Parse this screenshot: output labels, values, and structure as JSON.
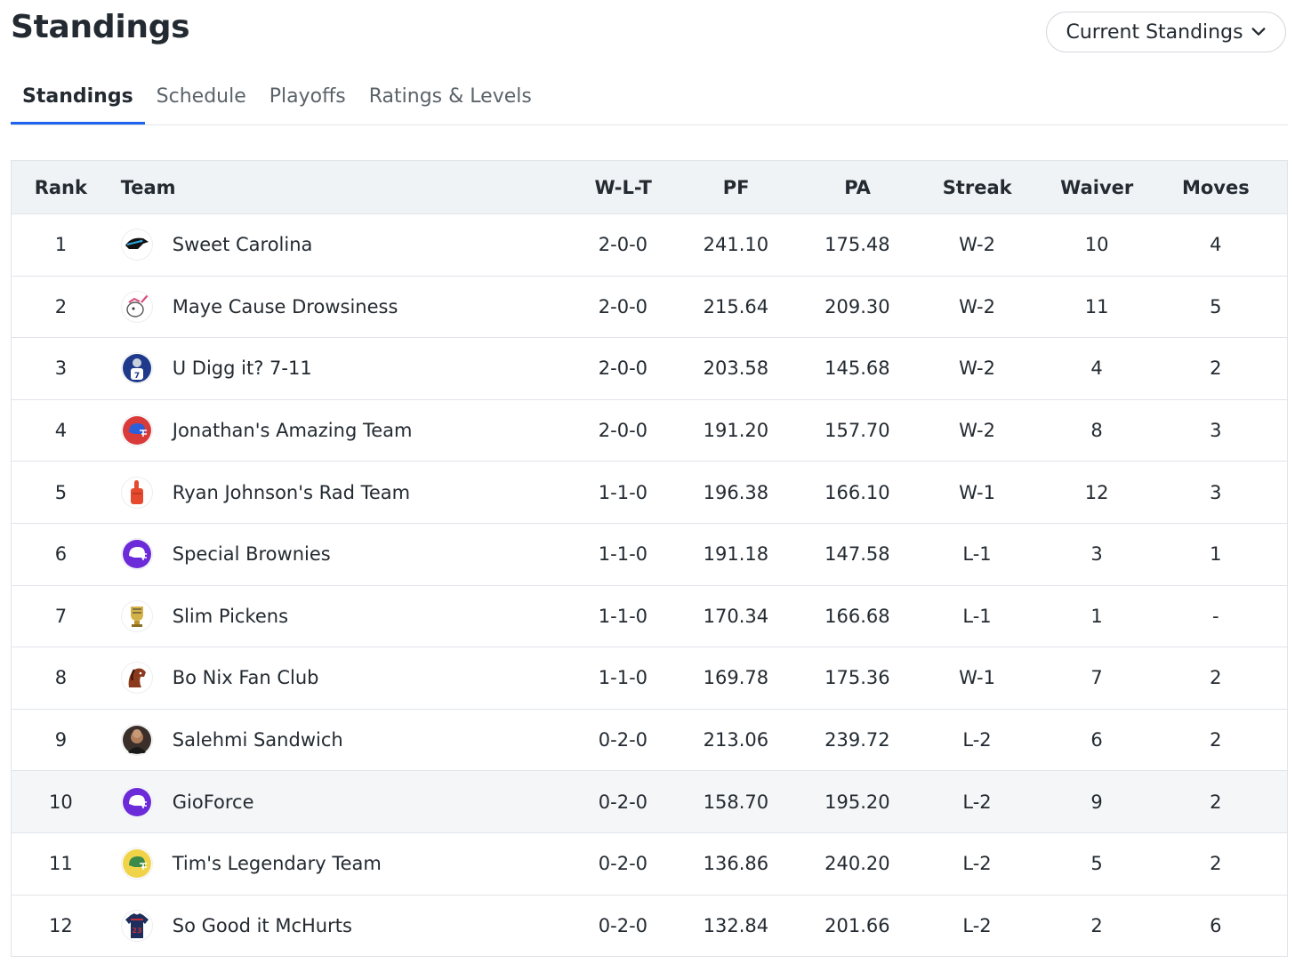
{
  "header": {
    "title": "Standings",
    "view_selector": "Current Standings"
  },
  "tabs": [
    {
      "label": "Standings",
      "active": true
    },
    {
      "label": "Schedule",
      "active": false
    },
    {
      "label": "Playoffs",
      "active": false
    },
    {
      "label": "Ratings & Levels",
      "active": false
    }
  ],
  "table": {
    "columns": {
      "rank": "Rank",
      "team": "Team",
      "wlt": "W-L-T",
      "pf": "PF",
      "pa": "PA",
      "streak": "Streak",
      "waiver": "Waiver",
      "moves": "Moves"
    },
    "rows": [
      {
        "rank": "1",
        "team": "Sweet Carolina",
        "wlt": "2-0-0",
        "pf": "241.10",
        "pa": "175.48",
        "streak": "W-2",
        "waiver": "10",
        "moves": "4",
        "logo": "panther-icon"
      },
      {
        "rank": "2",
        "team": "Maye Cause Drowsiness",
        "wlt": "2-0-0",
        "pf": "215.64",
        "pa": "209.30",
        "streak": "W-2",
        "waiver": "11",
        "moves": "5",
        "logo": "unicorn-icon"
      },
      {
        "rank": "3",
        "team": "U Digg it? 7-11",
        "wlt": "2-0-0",
        "pf": "203.58",
        "pa": "145.68",
        "streak": "W-2",
        "waiver": "4",
        "moves": "2",
        "logo": "player-jersey-icon"
      },
      {
        "rank": "4",
        "team": "Jonathan's Amazing Team",
        "wlt": "2-0-0",
        "pf": "191.20",
        "pa": "157.70",
        "streak": "W-2",
        "waiver": "8",
        "moves": "3",
        "logo": "helmet-icon"
      },
      {
        "rank": "5",
        "team": "Ryan Johnson's Rad Team",
        "wlt": "1-1-0",
        "pf": "196.38",
        "pa": "166.10",
        "streak": "W-1",
        "waiver": "12",
        "moves": "3",
        "logo": "foam-finger-icon"
      },
      {
        "rank": "6",
        "team": "Special Brownies",
        "wlt": "1-1-0",
        "pf": "191.18",
        "pa": "147.58",
        "streak": "L-1",
        "waiver": "3",
        "moves": "1",
        "logo": "helmet-icon"
      },
      {
        "rank": "7",
        "team": "Slim Pickens",
        "wlt": "1-1-0",
        "pf": "170.34",
        "pa": "166.68",
        "streak": "L-1",
        "waiver": "1",
        "moves": "-",
        "logo": "trophy-icon"
      },
      {
        "rank": "8",
        "team": "Bo Nix Fan Club",
        "wlt": "1-1-0",
        "pf": "169.78",
        "pa": "175.36",
        "streak": "W-1",
        "waiver": "7",
        "moves": "2",
        "logo": "bronco-icon"
      },
      {
        "rank": "9",
        "team": "Salehmi Sandwich",
        "wlt": "0-2-0",
        "pf": "213.06",
        "pa": "239.72",
        "streak": "L-2",
        "waiver": "6",
        "moves": "2",
        "logo": "avatar-photo-icon"
      },
      {
        "rank": "10",
        "team": "GioForce",
        "wlt": "0-2-0",
        "pf": "158.70",
        "pa": "195.20",
        "streak": "L-2",
        "waiver": "9",
        "moves": "2",
        "logo": "helmet-icon"
      },
      {
        "rank": "11",
        "team": "Tim's Legendary Team",
        "wlt": "0-2-0",
        "pf": "136.86",
        "pa": "240.20",
        "streak": "L-2",
        "waiver": "5",
        "moves": "2",
        "logo": "helmet-icon"
      },
      {
        "rank": "12",
        "team": "So Good it McHurts",
        "wlt": "0-2-0",
        "pf": "132.84",
        "pa": "201.66",
        "streak": "L-2",
        "waiver": "2",
        "moves": "6",
        "logo": "jersey-icon"
      }
    ]
  },
  "colors": {
    "accent": "#1d63ed",
    "text": "#232a31",
    "muted": "#5b636a",
    "header_bg": "#f0f3f5",
    "border": "#e0e4e9"
  }
}
